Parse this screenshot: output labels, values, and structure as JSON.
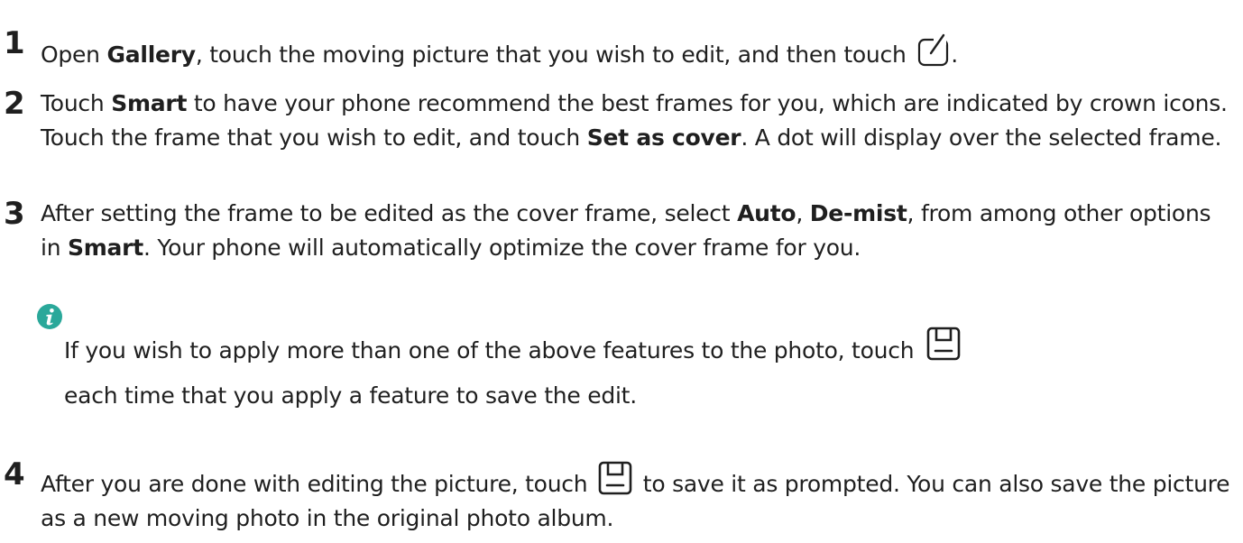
{
  "steps": [
    {
      "num": "1",
      "parts": [
        "Open ",
        "Gallery",
        ", touch the moving picture that you wish to edit, and then touch ",
        "."
      ]
    },
    {
      "num": "2",
      "parts": [
        "Touch ",
        "Smart",
        " to have your phone recommend the best frames for you, which are indicated by crown icons. Touch the frame that you wish to edit, and touch ",
        "Set as cover",
        ". A dot will display over the selected frame."
      ]
    },
    {
      "num": "3",
      "parts": [
        "After setting the frame to be edited as the cover frame, select ",
        "Auto",
        ", ",
        "De-mist",
        ", from among other options in ",
        "Smart",
        ". Your phone will automatically optimize the cover frame for you."
      ]
    },
    {
      "num": "4",
      "parts": [
        "After you are done with editing the picture, touch ",
        " to save it as prompted. You can also save the picture as a new moving photo in the original photo album."
      ]
    }
  ],
  "note": {
    "parts": [
      "If you wish to apply more than one of the above features to the photo, touch ",
      " each time that you apply a feature to save the edit."
    ]
  },
  "icons": {
    "edit": "edit-icon",
    "save": "save-icon",
    "info": "info-icon"
  },
  "colors": {
    "text": "#1f1f1f",
    "info_badge": "#2aa89a"
  }
}
